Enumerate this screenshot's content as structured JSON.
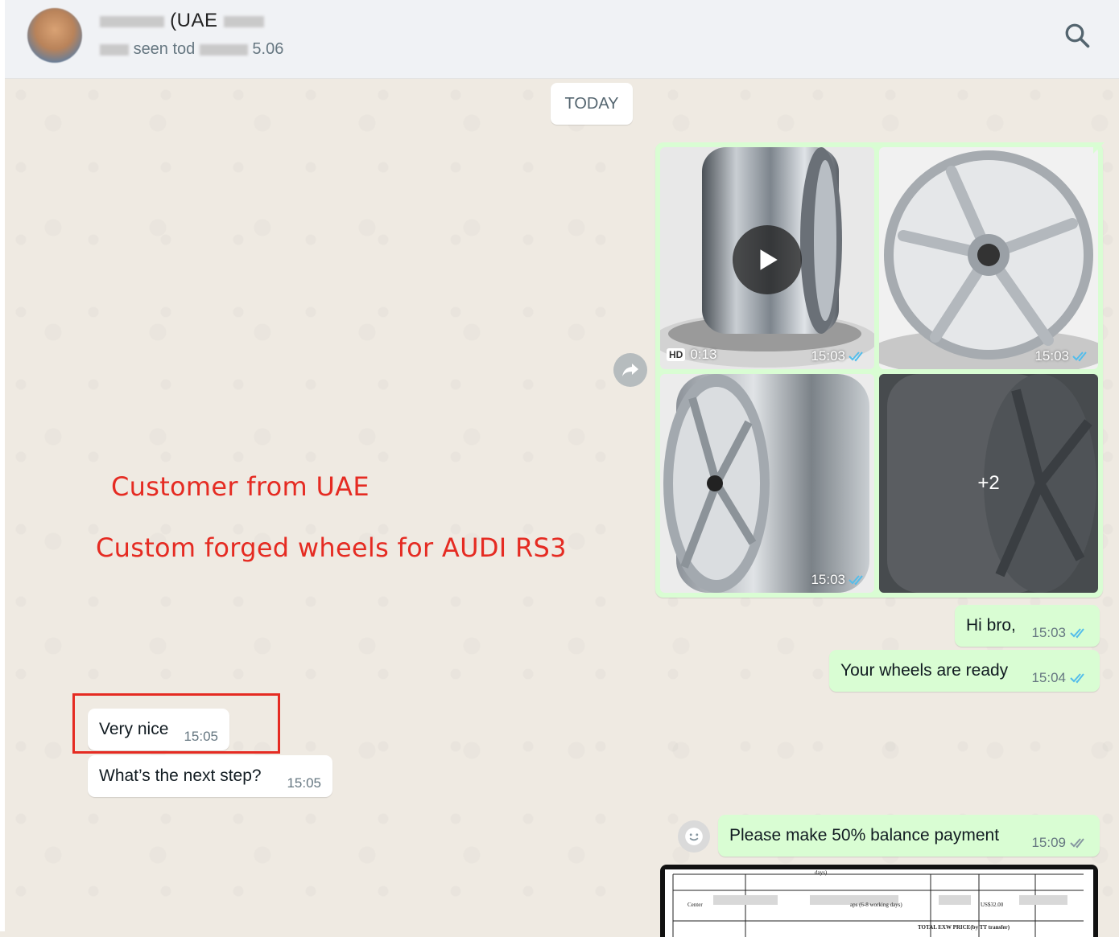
{
  "header": {
    "contact_name": "(UAE",
    "contact_status": "seen tod",
    "contact_status_time": "5.06",
    "search_icon": "search-icon"
  },
  "chat": {
    "date_chip": "TODAY",
    "media_group": {
      "video_duration": "0:13",
      "hd_label": "HD",
      "tiles": [
        {
          "time": "15:03"
        },
        {
          "time": "15:03"
        },
        {
          "time": "15:03"
        },
        {
          "time": "",
          "more_count": "+2"
        }
      ]
    },
    "messages": [
      {
        "direction": "out",
        "text": "Hi bro,",
        "time": "15:03"
      },
      {
        "direction": "out",
        "text": "Your wheels are ready",
        "time": "15:04"
      },
      {
        "direction": "in",
        "text": "Very nice",
        "time": "15:05"
      },
      {
        "direction": "in",
        "text": "What’s the next step?",
        "time": "15:05"
      },
      {
        "direction": "out",
        "text": "Please make 50% balance payment",
        "time": "15:09"
      }
    ],
    "document_preview": {
      "visible_text": [
        "days)",
        "Center",
        "aps (6-8 working days)",
        "US$32.00",
        "TOTAL EXW PRICE(by TT transfer)"
      ]
    }
  },
  "annotations": {
    "line1": "Customer from UAE",
    "line2": "Custom forged wheels for AUDI RS3"
  },
  "colors": {
    "outgoing_bubble": "#d9fdd3",
    "incoming_bubble": "#ffffff",
    "chat_background": "#efeae2",
    "read_tick": "#53bdeb",
    "annotation": "#e52b22"
  }
}
